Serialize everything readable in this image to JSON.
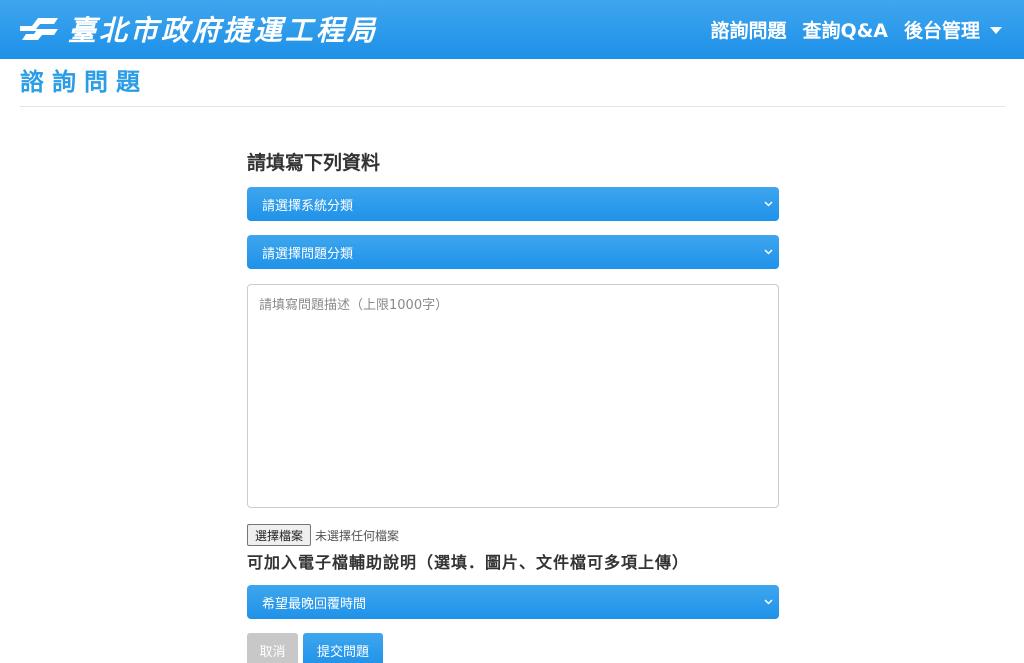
{
  "navbar": {
    "brand_name": "臺北市政府捷運工程局",
    "logo_icon": "metro-logo-icon",
    "links": [
      {
        "label": "諮詢問題"
      },
      {
        "label": "查詢Q&A"
      },
      {
        "label": "後台管理",
        "has_dropdown": true
      }
    ]
  },
  "page": {
    "title": "諮詢問題"
  },
  "form": {
    "heading": "請填寫下列資料",
    "system_category_select": "請選擇系統分類",
    "question_category_select": "請選擇問題分類",
    "description_placeholder": "請填寫問題描述（上限1000字）",
    "file_button": "選擇檔案",
    "file_status": "未選擇任何檔案",
    "file_help": "可加入電子檔輔助說明（選填．圖片、文件檔可多項上傳）",
    "reply_time_select": "希望最晚回覆時間",
    "cancel_button": "取消",
    "submit_button": "提交問題"
  },
  "colors": {
    "primary": "#2196e9",
    "title": "#2a9de6",
    "cancel": "#c8c8c8"
  }
}
